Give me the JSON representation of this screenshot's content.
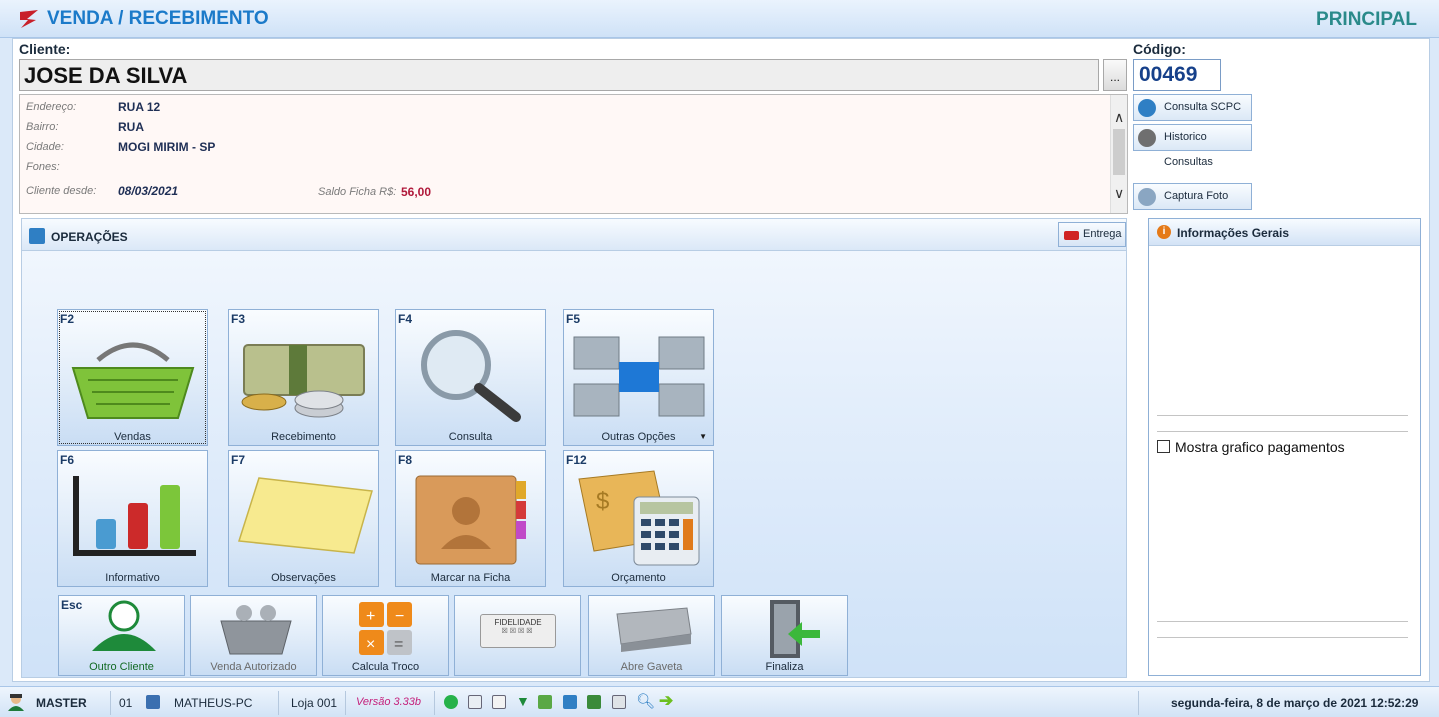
{
  "header": {
    "title": "VENDA / RECEBIMENTO",
    "section": "PRINCIPAL"
  },
  "client": {
    "label": "Cliente:",
    "name": "JOSE DA SILVA",
    "code_label": "Código:",
    "code": "00469",
    "details": {
      "endereco_label": "Endereço:",
      "endereco": "RUA 12",
      "bairro_label": "Bairro:",
      "bairro": "RUA",
      "cidade_label": "Cidade:",
      "cidade": "MOGI MIRIM - SP",
      "fones_label": "Fones:",
      "desde_label": "Cliente desde:",
      "desde": "08/03/2021",
      "saldo_label": "Saldo Ficha R$:",
      "saldo": "56,00"
    }
  },
  "side_buttons": {
    "consulta_scpc": "Consulta SCPC",
    "historico": "Historico Consultas",
    "captura": "Captura Foto"
  },
  "operations": {
    "title": "OPERAÇÕES",
    "entrega": "Entrega",
    "tiles": [
      {
        "key": "F2",
        "label": "Vendas"
      },
      {
        "key": "F3",
        "label": "Recebimento"
      },
      {
        "key": "F4",
        "label": "Consulta"
      },
      {
        "key": "F5",
        "label": "Outras Opções"
      },
      {
        "key": "F6",
        "label": "Informativo"
      },
      {
        "key": "F7",
        "label": "Observações"
      },
      {
        "key": "F8",
        "label": "Marcar na Ficha"
      },
      {
        "key": "F12",
        "label": "Orçamento"
      }
    ],
    "bottom": [
      {
        "key": "Esc",
        "label": "Outro Cliente"
      },
      {
        "label": "Venda Autorizado"
      },
      {
        "label": "Calcula Troco"
      },
      {
        "label": "FIDELIDADE"
      },
      {
        "label": "Abre Gaveta"
      },
      {
        "label": "Finaliza"
      }
    ]
  },
  "info_panel": {
    "title": "Informações Gerais",
    "checkbox_label": "Mostra grafico pagamentos"
  },
  "status": {
    "user": "MASTER",
    "terminal": "01",
    "machine": "MATHEUS-PC",
    "loja": "Loja 001",
    "versao": "Versão 3.33b",
    "datetime": "segunda-feira, 8 de março de 2021 12:52:29"
  }
}
